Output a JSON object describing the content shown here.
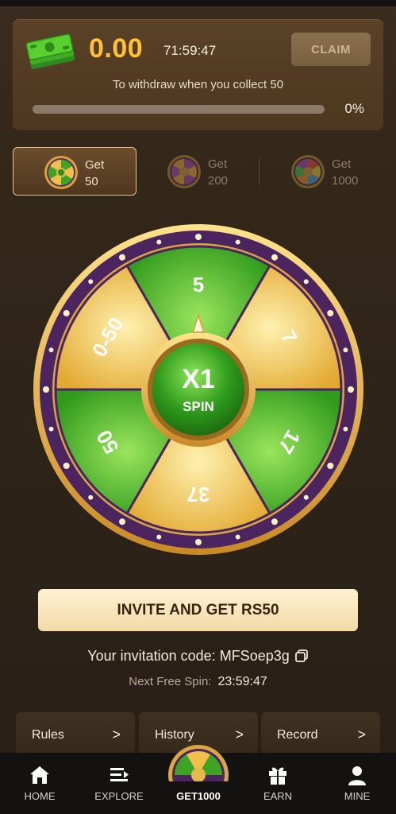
{
  "reward": {
    "amount": "0.00",
    "timer": "71:59:47",
    "claim_label": "CLAIM",
    "withdraw_note": "To withdraw when you collect 50",
    "progress_fraction": 0.0,
    "progress_label": "0%",
    "icon": "cash-stack-icon"
  },
  "tiers": [
    {
      "label": "Get",
      "value": "50",
      "active": true
    },
    {
      "label": "Get",
      "value": "200",
      "active": false
    },
    {
      "label": "Get",
      "value": "1000",
      "active": false
    }
  ],
  "wheel": {
    "segments": [
      "5",
      "7",
      "17",
      "37",
      "50",
      "0-50"
    ],
    "center_multiplier": "X1",
    "center_action": "SPIN",
    "colors": {
      "green": "#36a51f",
      "gold": "#e9b43d",
      "rim": "#4b2460",
      "frame": "#d8a840"
    }
  },
  "invite": {
    "button_label": "INVITE AND GET RS50",
    "code_text": "Your invitation code: MFSoep3g",
    "next_spin_label": "Next Free Spin:",
    "next_spin_time": "23:59:47"
  },
  "links": [
    {
      "label": "Rules",
      "chevron": ">"
    },
    {
      "label": "History",
      "chevron": ">"
    },
    {
      "label": "Record",
      "chevron": ">"
    }
  ],
  "nav": [
    {
      "label": "HOME",
      "icon": "home-icon"
    },
    {
      "label": "EXPLORE",
      "icon": "explore-icon"
    },
    {
      "label": "GET1000",
      "icon": "wheel-icon"
    },
    {
      "label": "EARN",
      "icon": "gift-icon"
    },
    {
      "label": "MINE",
      "icon": "user-icon"
    }
  ]
}
